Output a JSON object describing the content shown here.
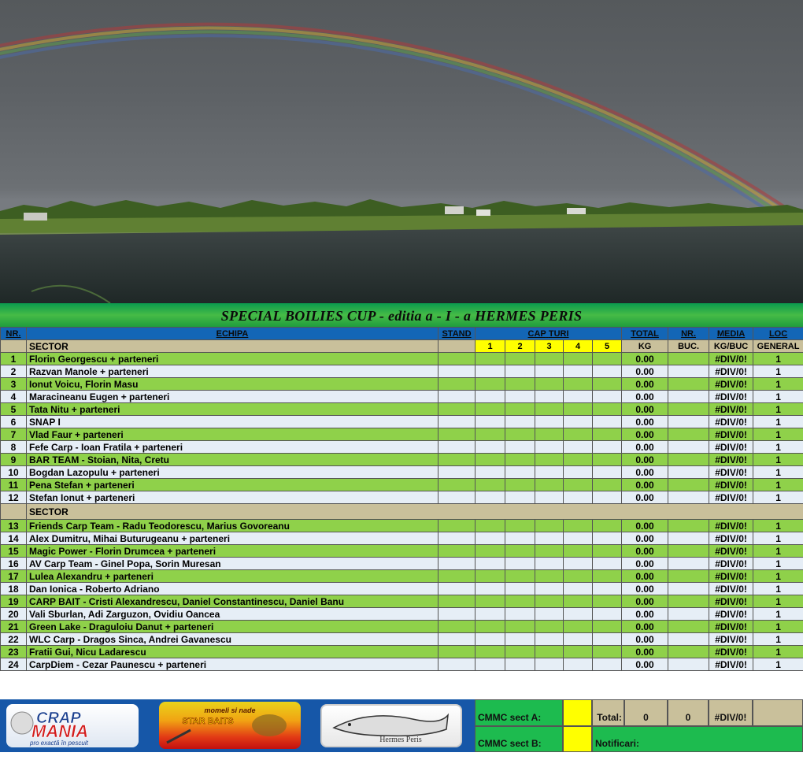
{
  "title": "SPECIAL BOILIES CUP - editia  a - I - a  HERMES PERIS",
  "header": {
    "nr": "NR.",
    "echipa": "ECHIPA",
    "stand": "STAND",
    "capturi_a": "CAP",
    "capturi_b": "TURI",
    "total": "TOTAL",
    "nr_buc": "NR.",
    "media": "MEDIA",
    "loc": "LOC"
  },
  "subheader": {
    "sector": "SECTOR",
    "turns": [
      "1",
      "2",
      "3",
      "4",
      "5"
    ],
    "kg": "KG",
    "buc": "BUC.",
    "kgbuc": "KG/BUC",
    "general": "GENERAL"
  },
  "sector_b_label": "SECTOR",
  "sector_a": [
    {
      "nr": "1",
      "name": "Florin Georgescu + parteneri",
      "kg": "0.00",
      "media": "#DIV/0!",
      "loc": "1"
    },
    {
      "nr": "2",
      "name": "Razvan Manole + parteneri",
      "kg": "0.00",
      "media": "#DIV/0!",
      "loc": "1"
    },
    {
      "nr": "3",
      "name": "Ionut Voicu, Florin Masu",
      "kg": "0.00",
      "media": "#DIV/0!",
      "loc": "1"
    },
    {
      "nr": "4",
      "name": "Maracineanu Eugen + parteneri",
      "kg": "0.00",
      "media": "#DIV/0!",
      "loc": "1"
    },
    {
      "nr": "5",
      "name": "Tata Nitu + parteneri",
      "kg": "0.00",
      "media": "#DIV/0!",
      "loc": "1"
    },
    {
      "nr": "6",
      "name": "SNAP I",
      "kg": "0.00",
      "media": "#DIV/0!",
      "loc": "1"
    },
    {
      "nr": "7",
      "name": "Vlad Faur + parteneri",
      "kg": "0.00",
      "media": "#DIV/0!",
      "loc": "1"
    },
    {
      "nr": "8",
      "name": "Fefe Carp - Ioan Fratila + parteneri",
      "kg": "0.00",
      "media": "#DIV/0!",
      "loc": "1"
    },
    {
      "nr": "9",
      "name": "BAR TEAM - Stoian, Nita, Cretu",
      "kg": "0.00",
      "media": "#DIV/0!",
      "loc": "1"
    },
    {
      "nr": "10",
      "name": "Bogdan Lazopulu + parteneri",
      "kg": "0.00",
      "media": "#DIV/0!",
      "loc": "1"
    },
    {
      "nr": "11",
      "name": "Pena Stefan + parteneri",
      "kg": "0.00",
      "media": "#DIV/0!",
      "loc": "1"
    },
    {
      "nr": "12",
      "name": "Stefan Ionut + parteneri",
      "kg": "0.00",
      "media": "#DIV/0!",
      "loc": "1"
    }
  ],
  "sector_b": [
    {
      "nr": "13",
      "name": "Friends Carp Team - Radu Teodorescu, Marius Govoreanu",
      "kg": "0.00",
      "media": "#DIV/0!",
      "loc": "1"
    },
    {
      "nr": "14",
      "name": "Alex Dumitru, Mihai Buturugeanu + parteneri",
      "kg": "0.00",
      "media": "#DIV/0!",
      "loc": "1"
    },
    {
      "nr": "15",
      "name": "Magic Power - Florin Drumcea + parteneri",
      "kg": "0.00",
      "media": "#DIV/0!",
      "loc": "1"
    },
    {
      "nr": "16",
      "name": "AV Carp Team - Ginel Popa, Sorin Muresan",
      "kg": "0.00",
      "media": "#DIV/0!",
      "loc": "1"
    },
    {
      "nr": "17",
      "name": "Lulea Alexandru + parteneri",
      "kg": "0.00",
      "media": "#DIV/0!",
      "loc": "1"
    },
    {
      "nr": "18",
      "name": "Dan Ionica - Roberto Adriano",
      "kg": "0.00",
      "media": "#DIV/0!",
      "loc": "1"
    },
    {
      "nr": "19",
      "name": "CARP BAIT -  Cristi Alexandrescu, Daniel Constantinescu, Daniel Banu",
      "kg": "0.00",
      "media": "#DIV/0!",
      "loc": "1"
    },
    {
      "nr": "20",
      "name": "Vali Sburlan, Adi Zarguzon, Ovidiu Oancea",
      "kg": "0.00",
      "media": "#DIV/0!",
      "loc": "1"
    },
    {
      "nr": "21",
      "name": "Green Lake - Draguloiu Danut + parteneri",
      "kg": "0.00",
      "media": "#DIV/0!",
      "loc": "1"
    },
    {
      "nr": "22",
      "name": "WLC Carp - Dragos Sinca, Andrei Gavanescu",
      "kg": "0.00",
      "media": "#DIV/0!",
      "loc": "1"
    },
    {
      "nr": "23",
      "name": "Fratii Gui, Nicu Ladarescu",
      "kg": "0.00",
      "media": "#DIV/0!",
      "loc": "1"
    },
    {
      "nr": "24",
      "name": "CarpDiem - Cezar Paunescu + parteneri",
      "kg": "0.00",
      "media": "#DIV/0!",
      "loc": "1"
    }
  ],
  "footer": {
    "cmmc_a": "CMMC sect A:",
    "cmmc_b": "CMMC sect B:",
    "total_label": "Total:",
    "total_kg": "0",
    "total_buc": "0",
    "total_media": "#DIV/0!",
    "notificari": "Notificari:"
  },
  "logos": {
    "crapmania": {
      "line1": "CRAP",
      "line2": "MANIA",
      "tagline": "pro exactă în pescuit"
    },
    "star_baits": {
      "top": "momeli si nade",
      "brand": "STAR BAITS"
    },
    "hermes_peris": {
      "text": "Hermes Peris"
    }
  },
  "colors": {
    "header_blue": "#1366b6",
    "row_green": "#8fd14a",
    "row_light": "#e6eef6",
    "sector_tan": "#c9c09b",
    "turn_yellow": "#ffff00",
    "title_green": "#2daf47",
    "footer_blue": "#1657a8",
    "footer_green": "#1dbb4f"
  }
}
